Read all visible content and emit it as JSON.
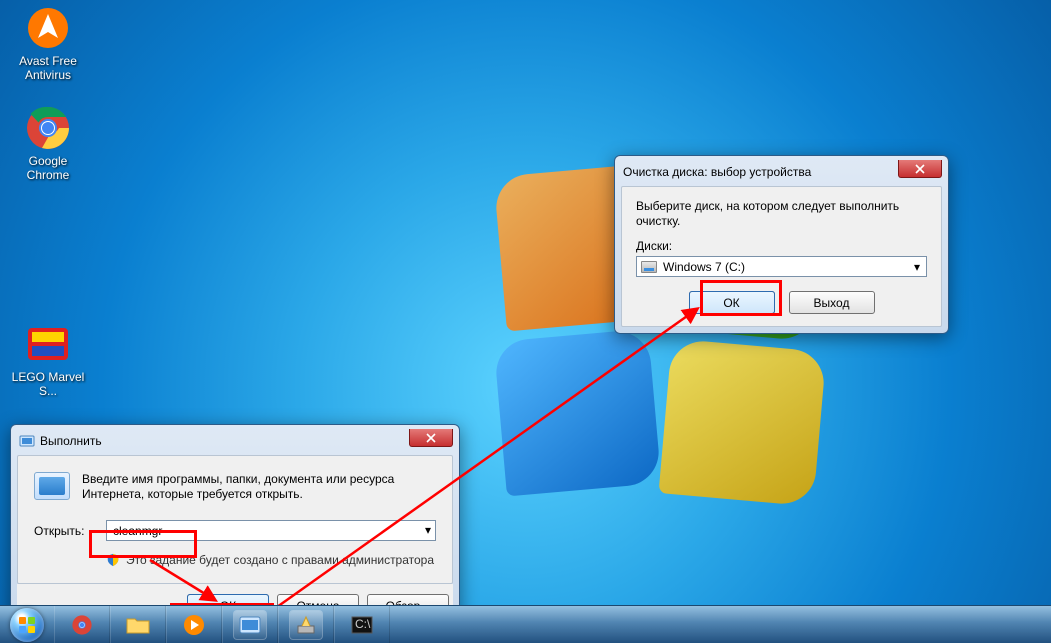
{
  "desktop": {
    "icons": [
      {
        "name": "avast",
        "label": "Avast Free\nAntivirus"
      },
      {
        "name": "chrome",
        "label": "Google\nChrome"
      },
      {
        "name": "lego",
        "label": "LEGO Marvel\nS..."
      }
    ]
  },
  "run_dialog": {
    "title": "Выполнить",
    "description": "Введите имя программы, папки, документа или ресурса Интернета, которые требуется открыть.",
    "open_label": "Открыть:",
    "input_value": "cleanmgr",
    "admin_note": "Это задание будет создано с правами администратора",
    "buttons": {
      "ok": "ОК",
      "cancel": "Отмена",
      "browse": "Обзор..."
    }
  },
  "cleanup_dialog": {
    "title": "Очистка диска: выбор устройства",
    "message": "Выберите диск, на котором следует выполнить очистку.",
    "drives_label": "Диски:",
    "selected_drive": "Windows 7 (C:)",
    "buttons": {
      "ok": "ОК",
      "exit": "Выход"
    }
  }
}
